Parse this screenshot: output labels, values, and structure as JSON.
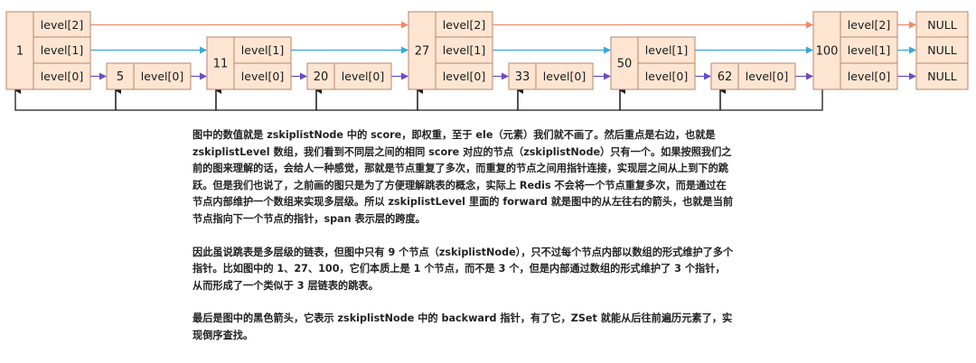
{
  "diagram": {
    "nodes": [
      {
        "score": "1",
        "levels": [
          "level[2]",
          "level[1]",
          "level[0]"
        ]
      },
      {
        "score": "5",
        "levels": [
          "level[0]"
        ]
      },
      {
        "score": "11",
        "levels": [
          "level[1]",
          "level[0]"
        ]
      },
      {
        "score": "20",
        "levels": [
          "level[0]"
        ]
      },
      {
        "score": "27",
        "levels": [
          "level[2]",
          "level[1]",
          "level[0]"
        ]
      },
      {
        "score": "33",
        "levels": [
          "level[0]"
        ]
      },
      {
        "score": "50",
        "levels": [
          "level[1]",
          "level[0]"
        ]
      },
      {
        "score": "62",
        "levels": [
          "level[0]"
        ]
      },
      {
        "score": "100",
        "levels": [
          "level[2]",
          "level[1]",
          "level[0]"
        ]
      }
    ],
    "null_labels": [
      "NULL",
      "NULL",
      "NULL"
    ],
    "colors": {
      "level2_arrow": "#f08a6c",
      "level1_arrow": "#37a8d8",
      "level0_arrow": "#6a4bc7",
      "backward_arrow": "#1a1a1a",
      "node_fill": "#fde5d2",
      "node_border": "#b8856a"
    }
  },
  "text": {
    "paragraph1": "图中的数值就是 zskiplistNode 中的 score，即权重，至于 ele（元素）我们就不画了。然后重点是右边，也就是 zskiplistLevel 数组，我们看到不同层之间的相同 score 对应的节点（zskiplistNode）只有一个。如果按照我们之前的图来理解的话，会给人一种感觉，那就是节点重复了多次，而重复的节点之间用指针连接，实现层之间从上到下的跳跃。但是我们也说了，之前画的图只是为了方便理解跳表的概念，实际上 Redis 不会将一个节点重复多次，而是通过在节点内部维护一个数组来实现多层级。所以 zskiplistLevel 里面的 forward 就是图中的从左往右的箭头，也就是当前节点指向下一个节点的指针，span 表示层的跨度。",
    "paragraph2": "因此虽说跳表是多层级的链表，但图中只有 9 个节点（zskiplistNode），只不过每个节点内部以数组的形式维护了多个指针。比如图中的 1、27、100，它们本质上是 1 个节点，而不是 3 个，但是内部通过数组的形式维护了 3 个指针，从而形成了一个类似于 3 层链表的跳表。",
    "paragraph3": "最后是图中的黑色箭头，它表示 zskiplistNode 中的 backward 指针，有了它，ZSet 就能从后往前遍历元素了，实现倒序查找。"
  }
}
